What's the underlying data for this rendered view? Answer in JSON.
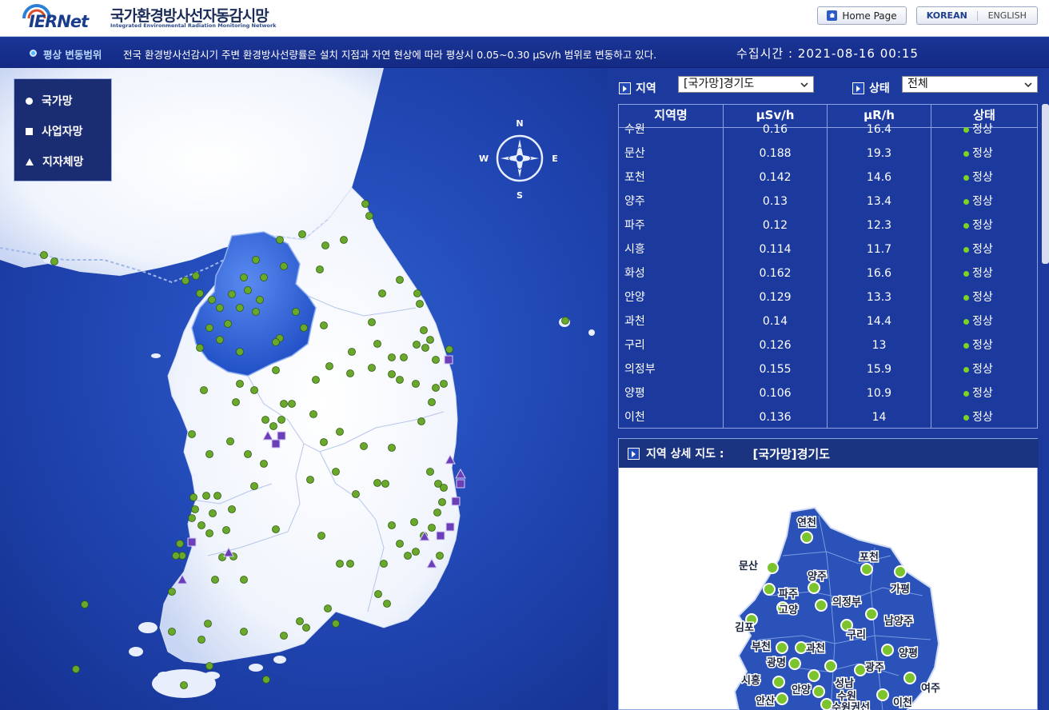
{
  "header": {
    "logo_text": "IERNet",
    "site_title": "국가환경방사선자동감시망",
    "site_subtitle": "Integrated Environmental Radiation Monitoring Network",
    "home_button": "Home Page",
    "lang_korean": "KOREAN",
    "lang_english": "ENGLISH"
  },
  "infobar": {
    "range_label": "평상 변동범위",
    "range_text": "전국 환경방사선감시기 주변 환경방사선량률은 설치 지점과 자연 현상에 따라 평상시 0.05~0.30 μSv/h 범위로 변동하고 있다.",
    "time_label": "수집시간 : 2021-08-16 00:15"
  },
  "legend": {
    "national": "국가망",
    "operator": "사업자망",
    "local": "지자체망"
  },
  "compass": {
    "n": "N",
    "s": "S",
    "e": "E",
    "w": "W"
  },
  "filters": {
    "region_label": "지역",
    "region_value": "[국가망]경기도",
    "status_label": "상태",
    "status_value": "전체"
  },
  "table": {
    "headers": [
      "지역명",
      "μSv/h",
      "μR/h",
      "상태"
    ],
    "rows": [
      {
        "name": "수원",
        "usv": "0.16",
        "ur": "16.4",
        "status": "정상"
      },
      {
        "name": "문산",
        "usv": "0.188",
        "ur": "19.3",
        "status": "정상"
      },
      {
        "name": "포천",
        "usv": "0.142",
        "ur": "14.6",
        "status": "정상"
      },
      {
        "name": "양주",
        "usv": "0.13",
        "ur": "13.4",
        "status": "정상"
      },
      {
        "name": "파주",
        "usv": "0.12",
        "ur": "12.3",
        "status": "정상"
      },
      {
        "name": "시흥",
        "usv": "0.114",
        "ur": "11.7",
        "status": "정상"
      },
      {
        "name": "화성",
        "usv": "0.162",
        "ur": "16.6",
        "status": "정상"
      },
      {
        "name": "안양",
        "usv": "0.129",
        "ur": "13.3",
        "status": "정상"
      },
      {
        "name": "과천",
        "usv": "0.14",
        "ur": "14.4",
        "status": "정상"
      },
      {
        "name": "구리",
        "usv": "0.126",
        "ur": "13",
        "status": "정상"
      },
      {
        "name": "의정부",
        "usv": "0.155",
        "ur": "15.9",
        "status": "정상"
      },
      {
        "name": "양평",
        "usv": "0.106",
        "ur": "10.9",
        "status": "정상"
      },
      {
        "name": "이천",
        "usv": "0.136",
        "ur": "14",
        "status": "정상"
      }
    ]
  },
  "detail": {
    "title": "지역 상세 지도 :",
    "region": "[국가망]경기도",
    "labels": [
      "연천",
      "포천",
      "문산",
      "양주",
      "가평",
      "파주",
      "고양",
      "의정부",
      "남양주",
      "김포",
      "구리",
      "부천",
      "과천",
      "양평",
      "광명",
      "광주",
      "시흥",
      "성남",
      "여주",
      "안양",
      "수원",
      "안산",
      "이천",
      "수원권선"
    ]
  },
  "colors": {
    "station": "#6aa82b",
    "operator": "#6b3fb8",
    "accent": "#1c3a9e"
  }
}
